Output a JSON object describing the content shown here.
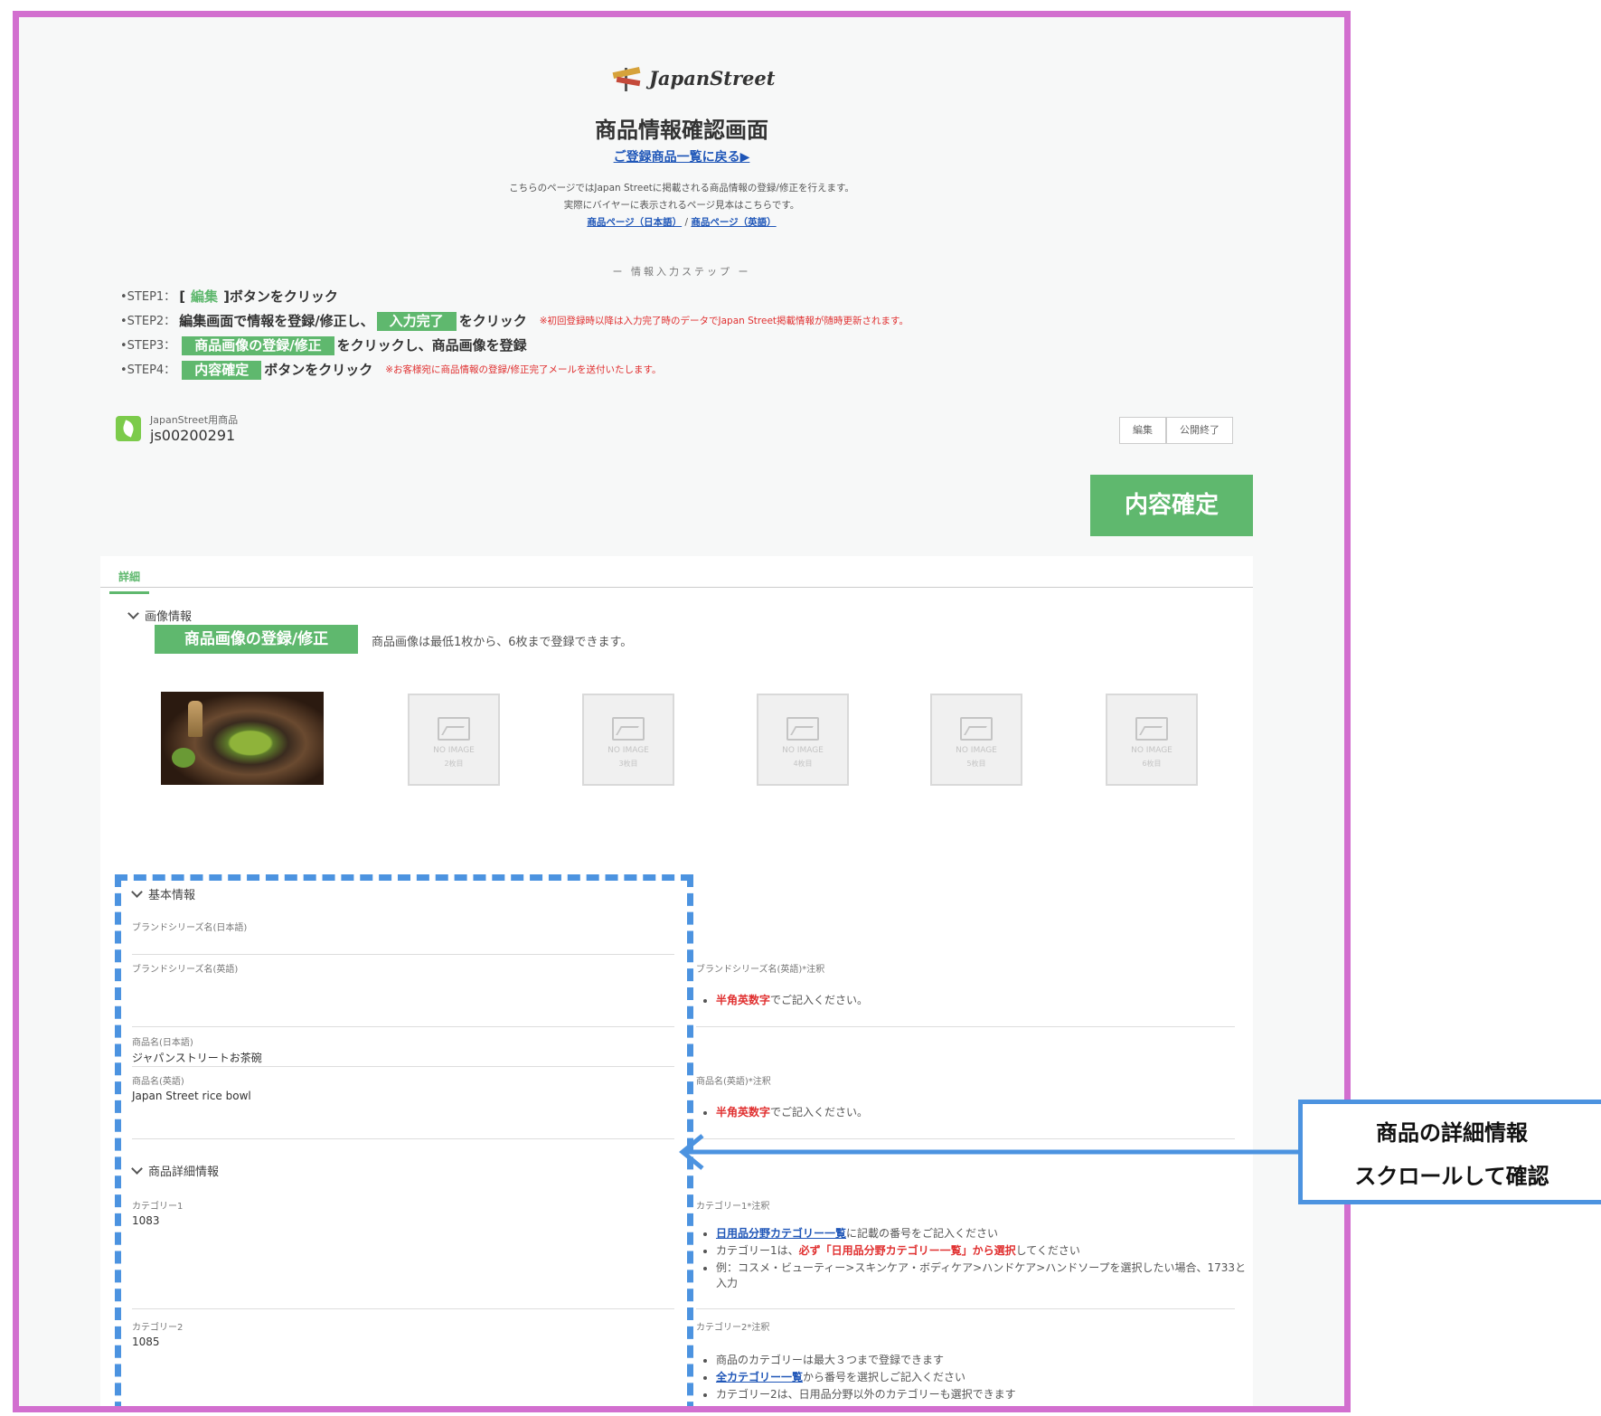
{
  "header": {
    "brand": "JapanStreet",
    "title": "商品情報確認画面",
    "back_link": "ご登録商品一覧に戻る▶",
    "intro_line1": "こちらのページではJapan Streetに掲載される商品情報の登録/修正を行えます。",
    "intro_line2": "実際にバイヤーに表示されるページ見本はこちらです。",
    "link_jp": "商品ページ（日本語）",
    "link_sep": "/",
    "link_en": "商品ページ（英語）"
  },
  "steps": {
    "heading": "ー 情報入力ステップ ー",
    "s1_label": "•STEP1：",
    "s1_pre": "[",
    "s1_btn": "編集",
    "s1_post": "]ボタンをクリック",
    "s2_label": "•STEP2：",
    "s2_pre": "編集画面で情報を登録/修正し、",
    "s2_btn": "入力完了",
    "s2_post": "をクリック",
    "s2_note": "※初回登録時以降は入力完了時のデータでJapan Street掲載情報が随時更新されます。",
    "s3_label": "•STEP3：",
    "s3_btn": "商品画像の登録/修正",
    "s3_post": "をクリックし、商品画像を登録",
    "s4_label": "•STEP4：",
    "s4_btn": "内容確定",
    "s4_post": "ボタンをクリック",
    "s4_note": "※お客様宛に商品情報の登録/修正完了メールを送付いたします。"
  },
  "product": {
    "type_label": "JapanStreet用商品",
    "code": "js00200291",
    "edit_btn": "編集",
    "unpublish_btn": "公開終了",
    "confirm_btn": "内容確定"
  },
  "tabs": {
    "detail": "詳細"
  },
  "image_section": {
    "title": "画像情報",
    "button": "商品画像の登録/修正",
    "note": "商品画像は最低1枚から、6枚まで登録できます。",
    "slots": [
      {
        "label": "NO IMAGE",
        "count": "2枚目"
      },
      {
        "label": "NO IMAGE",
        "count": "3枚目"
      },
      {
        "label": "NO IMAGE",
        "count": "4枚目"
      },
      {
        "label": "NO IMAGE",
        "count": "5枚目"
      },
      {
        "label": "NO IMAGE",
        "count": "6枚目"
      }
    ]
  },
  "basic": {
    "title": "基本情報",
    "brand_jp_label": "ブランドシリーズ名(日本語)",
    "brand_en_label": "ブランドシリーズ名(英語)",
    "brand_en_note_label": "ブランドシリーズ名(英語)*注釈",
    "brand_en_note_red": "半角英数字",
    "brand_en_note_rest": "でご記入ください。",
    "name_jp_label": "商品名(日本語)",
    "name_jp_value": "ジャパンストリートお茶碗",
    "name_en_label": "商品名(英語)",
    "name_en_value": "Japan Street rice bowl",
    "name_en_note_label": "商品名(英語)*注釈",
    "name_en_note_red": "半角英数字",
    "name_en_note_rest": "でご記入ください。"
  },
  "detail": {
    "title": "商品詳細情報",
    "cat1_label": "カテゴリー1",
    "cat1_value": "1083",
    "cat1_note_label": "カテゴリー1*注釈",
    "cat1_b1_link": "日用品分野カテゴリー一覧",
    "cat1_b1_rest": "に記載の番号をご記入ください",
    "cat1_b2_pre": "カテゴリー1は、",
    "cat1_b2_red": "必ず「日用品分野カテゴリー一覧」から選択",
    "cat1_b2_post": "してください",
    "cat1_b3": "例：コスメ・ビューティー>スキンケア・ボディケア>ハンドケア>ハンドソープを選択したい場合、1733と入力",
    "cat2_label": "カテゴリー2",
    "cat2_value": "1085",
    "cat2_note_label": "カテゴリー2*注釈",
    "cat2_b1": "商品のカテゴリーは最大３つまで登録できます",
    "cat2_b2_link": "全カテゴリー一覧",
    "cat2_b2_rest": "から番号を選択しご記入ください",
    "cat2_b3": "カテゴリー2は、日用品分野以外のカテゴリーも選択できます"
  },
  "callout": {
    "line1": "商品の詳細情報",
    "line2": "スクロールして確認"
  },
  "colors": {
    "frame": "#d26fcf",
    "accent_green": "#5fb86e",
    "dash_blue": "#4c93e0",
    "link_blue": "#1f56b8",
    "note_red": "#e03030"
  }
}
